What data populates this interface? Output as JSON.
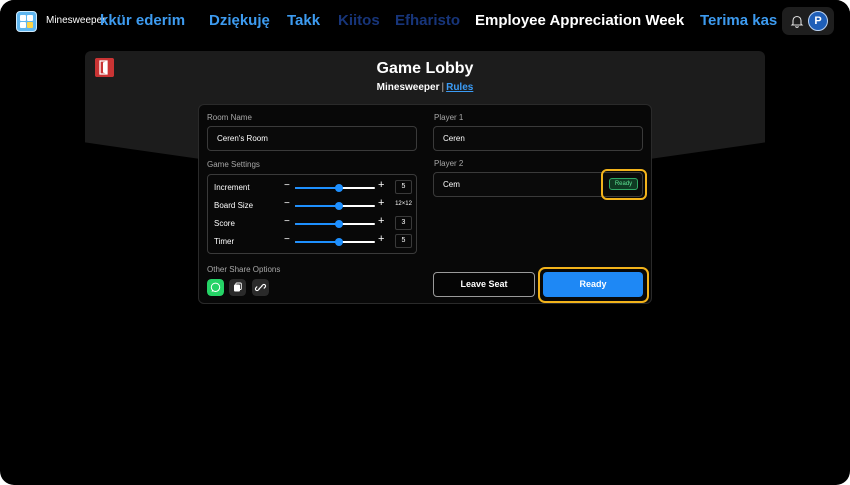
{
  "app": {
    "name": "Minesweeper",
    "avatar_letter": "P"
  },
  "marquee": [
    {
      "text": "kkür ederim",
      "color": "#3d9bf0"
    },
    {
      "text": "Dziękuję",
      "color": "#3d9bf0"
    },
    {
      "text": "Takk",
      "color": "#3d9bf0"
    },
    {
      "text": "Kiitos",
      "color": "#17357a"
    },
    {
      "text": "Efharisto",
      "color": "#17357a"
    },
    {
      "text": "Employee Appreciation Week",
      "color": "#ffffff"
    },
    {
      "text": "Terima kas",
      "color": "#3d9bf0"
    }
  ],
  "lobby": {
    "title": "Game Lobby",
    "game": "Minesweeper",
    "separator": "|",
    "rules_link": "Rules"
  },
  "room": {
    "label": "Room Name",
    "value": "Ceren's Room"
  },
  "settings": {
    "label": "Game Settings",
    "rows": [
      {
        "name": "Increment",
        "value": "5",
        "level": 0.55
      },
      {
        "name": "Board Size",
        "value": "12×12",
        "level": 0.55
      },
      {
        "name": "Score",
        "value": "3",
        "level": 0.55
      },
      {
        "name": "Timer",
        "value": "5",
        "level": 0.55
      }
    ],
    "minus": "−",
    "plus": "+"
  },
  "share": {
    "label": "Other Share Options",
    "buttons": [
      {
        "icon": "whatsapp-icon",
        "color": "#25d366"
      },
      {
        "icon": "copy-icon",
        "color": "#2a2a2a"
      },
      {
        "icon": "link-icon",
        "color": "#2a2a2a"
      }
    ]
  },
  "players": {
    "player1_label": "Player 1",
    "player1_value": "Ceren",
    "player2_label": "Player 2",
    "player2_value": "Cem",
    "player2_status": "Ready"
  },
  "actions": {
    "leave_label": "Leave Seat",
    "ready_label": "Ready"
  },
  "colors": {
    "accent": "#1e88f5",
    "highlight": "#f2b31b",
    "exit": "#c93434"
  }
}
